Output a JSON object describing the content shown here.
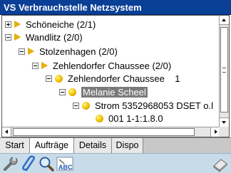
{
  "title": "VS Verbrauchstelle Netzsystem",
  "tree": {
    "nodes": [
      {
        "label": "Schöneiche (2/1)",
        "icon": "flag-icon",
        "expander": "plus",
        "level": 0
      },
      {
        "label": "Wandlitz (2/0)",
        "icon": "flag-icon",
        "expander": "minus",
        "level": 0
      },
      {
        "label": "Stolzenhagen (2/0)",
        "icon": "flag-icon",
        "expander": "minus",
        "level": 1
      },
      {
        "label": "Zehlendorfer Chaussee (2/0)",
        "icon": "flag-icon",
        "expander": "minus",
        "level": 2
      },
      {
        "label": "Zehlendorfer Chaussee    1",
        "icon": "dot-icon",
        "expander": "minus",
        "level": 3
      },
      {
        "label": "Melanie Scheel",
        "icon": "dot-icon",
        "expander": "minus",
        "level": 4,
        "selected": true
      },
      {
        "label": "Strom 5352968053 DSET o.l",
        "icon": "dot-icon",
        "expander": "minus",
        "level": 5
      },
      {
        "label": "001 1-1:1.8.0",
        "icon": "dot-icon",
        "expander": "none",
        "level": 6
      }
    ]
  },
  "tabs": [
    {
      "label": "Start",
      "active": false
    },
    {
      "label": "Aufträge",
      "active": true
    },
    {
      "label": "Details",
      "active": false
    },
    {
      "label": "Dispo",
      "active": false
    }
  ],
  "toolbar": {
    "icons": [
      "wrench-icon",
      "paperclip-icon",
      "magnifier-icon",
      "spellcheck-icon",
      "eraser-icon"
    ],
    "spell_label": "ABC"
  },
  "colors": {
    "titlebar": "#0a3f96",
    "selection": "#7a7a7a",
    "flag": "#e8b000",
    "dot": "#f5c800",
    "toolbar": "#c7dbe9"
  }
}
